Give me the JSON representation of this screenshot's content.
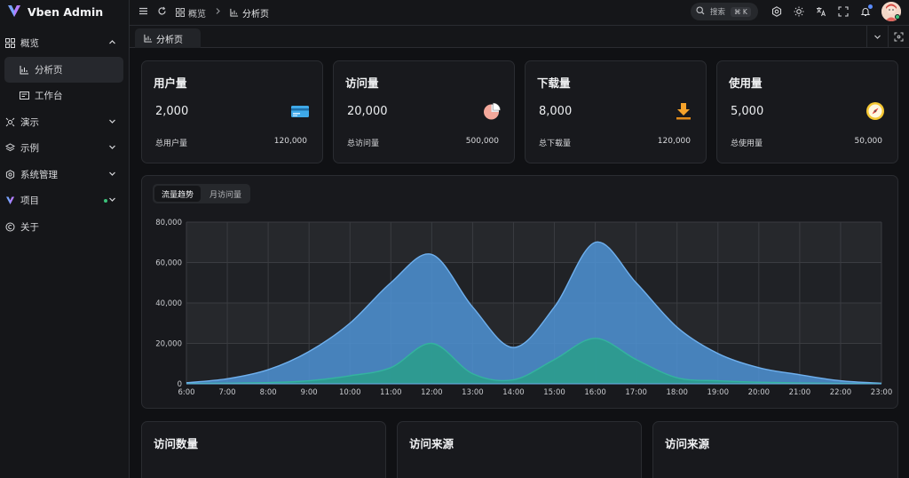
{
  "app": {
    "name": "Vben Admin"
  },
  "sidebar": {
    "items": [
      {
        "label": "概览",
        "icon": "dashboard-grid-icon",
        "expanded": true
      },
      {
        "label": "分析页",
        "icon": "chart-icon",
        "sub": true,
        "active": true
      },
      {
        "label": "工作台",
        "icon": "workbench-icon",
        "sub": true
      },
      {
        "label": "演示",
        "icon": "demo-icon"
      },
      {
        "label": "示例",
        "icon": "layers-icon"
      },
      {
        "label": "系统管理",
        "icon": "gear-icon"
      },
      {
        "label": "项目",
        "icon": "vben-logo-icon"
      },
      {
        "label": "关于",
        "icon": "copyright-icon"
      }
    ]
  },
  "header": {
    "breadcrumb": [
      "概览",
      "分析页"
    ],
    "search": {
      "placeholder": "搜索",
      "shortcut": "⌘ K"
    }
  },
  "tabs": [
    {
      "label": "分析页"
    }
  ],
  "stats": [
    {
      "title": "用户量",
      "value": "2,000",
      "foot_label": "总用户量",
      "foot_value": "120,000",
      "icon": "card-icon"
    },
    {
      "title": "访问量",
      "value": "20,000",
      "foot_label": "总访问量",
      "foot_value": "500,000",
      "icon": "pie-chart-icon"
    },
    {
      "title": "下载量",
      "value": "8,000",
      "foot_label": "总下载量",
      "foot_value": "120,000",
      "icon": "download-icon"
    },
    {
      "title": "使用量",
      "value": "5,000",
      "foot_label": "总使用量",
      "foot_value": "50,000",
      "icon": "compass-icon"
    }
  ],
  "trend_tabs": [
    "流量趋势",
    "月访问量"
  ],
  "chart_data": {
    "type": "area",
    "x": [
      "6:00",
      "7:00",
      "8:00",
      "9:00",
      "10:00",
      "11:00",
      "12:00",
      "13:00",
      "14:00",
      "15:00",
      "16:00",
      "17:00",
      "18:00",
      "19:00",
      "20:00",
      "21:00",
      "22:00",
      "23:00"
    ],
    "ylim": [
      0,
      80000
    ],
    "yticks": [
      "0",
      "20,000",
      "40,000",
      "60,000",
      "80,000"
    ],
    "yticks_values": [
      0,
      20000,
      40000,
      60000,
      80000
    ],
    "grid": true,
    "series": [
      {
        "values": [
          500,
          2500,
          7000,
          16000,
          30000,
          50000,
          64000,
          38000,
          18000,
          38000,
          70000,
          50000,
          28000,
          15000,
          8000,
          4500,
          1500,
          300
        ],
        "color": "#4f93d6"
      },
      {
        "values": [
          100,
          300,
          600,
          1500,
          4000,
          8000,
          20000,
          5000,
          2000,
          12000,
          22500,
          12000,
          3000,
          1500,
          800,
          400,
          200,
          100
        ],
        "color": "#2b9c8d"
      }
    ]
  },
  "bottom_cards": [
    {
      "title": "访问数量"
    },
    {
      "title": "访问来源"
    },
    {
      "title": "访问来源"
    }
  ]
}
